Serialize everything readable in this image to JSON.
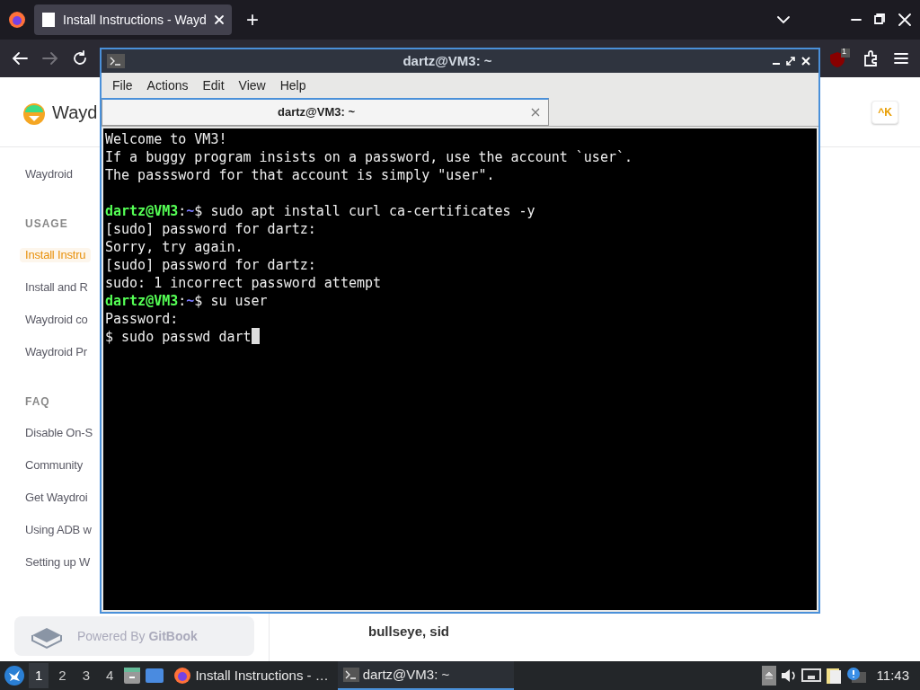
{
  "browser": {
    "tabs": [
      {
        "label": "Install Instructions - Wayd",
        "selected": true
      }
    ],
    "new_tab": "+",
    "toolbar": {
      "forward_disabled": true,
      "extension_badge": "1"
    }
  },
  "page": {
    "logo_text": "Wayd",
    "search_shortcut": "^K",
    "sidebar": [
      {
        "kind": "item",
        "label": "Waydroid",
        "selected": false
      },
      {
        "kind": "heading",
        "label": "USAGE"
      },
      {
        "kind": "item",
        "label": "Install Instru",
        "selected": true
      },
      {
        "kind": "item",
        "label": "Install and R",
        "selected": false
      },
      {
        "kind": "item",
        "label": "Waydroid co",
        "selected": false
      },
      {
        "kind": "item",
        "label": "Waydroid Pr",
        "selected": false
      },
      {
        "kind": "heading",
        "label": "FAQ"
      },
      {
        "kind": "item",
        "label": "Disable On-S",
        "selected": false
      },
      {
        "kind": "item",
        "label": "Community",
        "selected": false
      },
      {
        "kind": "item",
        "label": "Get Waydroi",
        "selected": false
      },
      {
        "kind": "item",
        "label": "Using ADB w",
        "selected": false
      },
      {
        "kind": "item",
        "label": "Setting up W",
        "selected": false
      }
    ],
    "powered_by": {
      "prefix": "Powered By",
      "brand": "GitBook"
    },
    "content_text": "bullseye, sid"
  },
  "terminal": {
    "title": "dartz@VM3: ~",
    "menu": [
      "File",
      "Actions",
      "Edit",
      "View",
      "Help"
    ],
    "tabs": [
      {
        "label": "dartz@VM3: ~",
        "selected": true
      }
    ],
    "lines": [
      {
        "kind": "output",
        "text": "Welcome to VM3!"
      },
      {
        "kind": "output",
        "text": "If a buggy program insists on a password, use the account `user`."
      },
      {
        "kind": "output",
        "text": "The passsword for that account is simply \"user\"."
      },
      {
        "kind": "blank"
      },
      {
        "kind": "prompt",
        "user": "dartz@VM3",
        "colon": ":",
        "path": "~",
        "command": "$ sudo apt install curl ca-certificates -y"
      },
      {
        "kind": "output",
        "text": "[sudo] password for dartz:"
      },
      {
        "kind": "output",
        "text": "Sorry, try again."
      },
      {
        "kind": "output",
        "text": "[sudo] password for dartz:"
      },
      {
        "kind": "output",
        "text": "sudo: 1 incorrect password attempt"
      },
      {
        "kind": "prompt",
        "user": "dartz@VM3",
        "colon": ":",
        "path": "~",
        "command": "$ su user"
      },
      {
        "kind": "output",
        "text": "Password:"
      },
      {
        "kind": "output",
        "text": "$ sudo passwd dart"
      }
    ],
    "cursor": true
  },
  "taskbar": {
    "workspaces": [
      {
        "label": "1",
        "selected": true
      },
      {
        "label": "2",
        "selected": false
      },
      {
        "label": "3",
        "selected": false
      },
      {
        "label": "4",
        "selected": false
      }
    ],
    "tasks": [
      {
        "kind": "browser",
        "label": "Install Instructions - …",
        "selected": false
      },
      {
        "kind": "terminal",
        "label": "dartz@VM3: ~",
        "selected": true
      }
    ],
    "clock": "11:43"
  }
}
